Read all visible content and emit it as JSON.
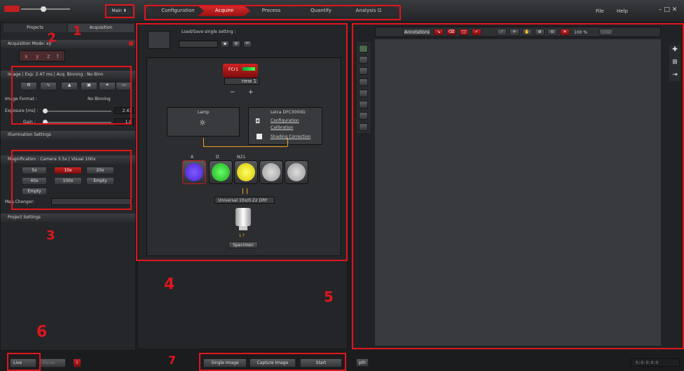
{
  "menu": {
    "main": "Main",
    "file": "File",
    "help": "Help"
  },
  "workflow_tabs": [
    {
      "label": "Configuration"
    },
    {
      "label": "Acquire"
    },
    {
      "label": "Process"
    },
    {
      "label": "Quantify"
    },
    {
      "label": "Analysis"
    }
  ],
  "left_panel": {
    "tabs": [
      "Projects",
      "Acquisition"
    ],
    "acq_mode_header": "Acquisition Mode: xy",
    "axes": [
      "x",
      "y",
      "z",
      "t"
    ],
    "image_header": "Image | Exp. 2.47 ms | Acq. Binning : No Binn",
    "image_format_label": "Image Format :",
    "image_format_value": "No Binning",
    "exposure_label": "Exposure [ms] :",
    "exposure_value": "2.47",
    "gain_label": "Gain :",
    "gain_value": "1.0",
    "illumination_header": "Illumination Settings",
    "magnification_header": "Magnification : Camera 3.5x | Visual 100x",
    "mag_buttons": [
      "5x",
      "10x",
      "20x",
      "40x",
      "100x",
      "Empty",
      "Empty"
    ],
    "mag_changer_label": "Mag.Changer:",
    "project_settings_header": "Project Settings"
  },
  "center_panel": {
    "load_save_label": "Load/Save single setting :",
    "fcr_label": "FCr1",
    "new_label": "new 1",
    "lamp_label": "Lamp",
    "camera_label": "Leica DFC3000G",
    "configuration_link": "Configuration",
    "calibration_link": "Calibration",
    "shading_link": "Shading Correction",
    "filter_labels": [
      "A",
      "D",
      "N21",
      "",
      ""
    ],
    "objective_label": "Universal",
    "objective_value": "10x/0.22 DRY",
    "specimen_label": "Specimen"
  },
  "viewer": {
    "annotations_label": "Annotations",
    "zoom": "100 %",
    "live_label": "Live"
  },
  "bottom_bar": {
    "live": "Live",
    "pause": "Pause",
    "single_image": "Single Image",
    "capture_image": "Capture Image",
    "start": "Start",
    "right_button": "pth",
    "counter": "0:0:0:0:0"
  },
  "annotations": [
    "1",
    "2",
    "3",
    "4",
    "5",
    "6",
    "7"
  ],
  "colors": {
    "accent_red": "#e0161d",
    "filter_a": "#5a2be0",
    "filter_d": "#2fd02f",
    "filter_n21": "#e8d800"
  }
}
